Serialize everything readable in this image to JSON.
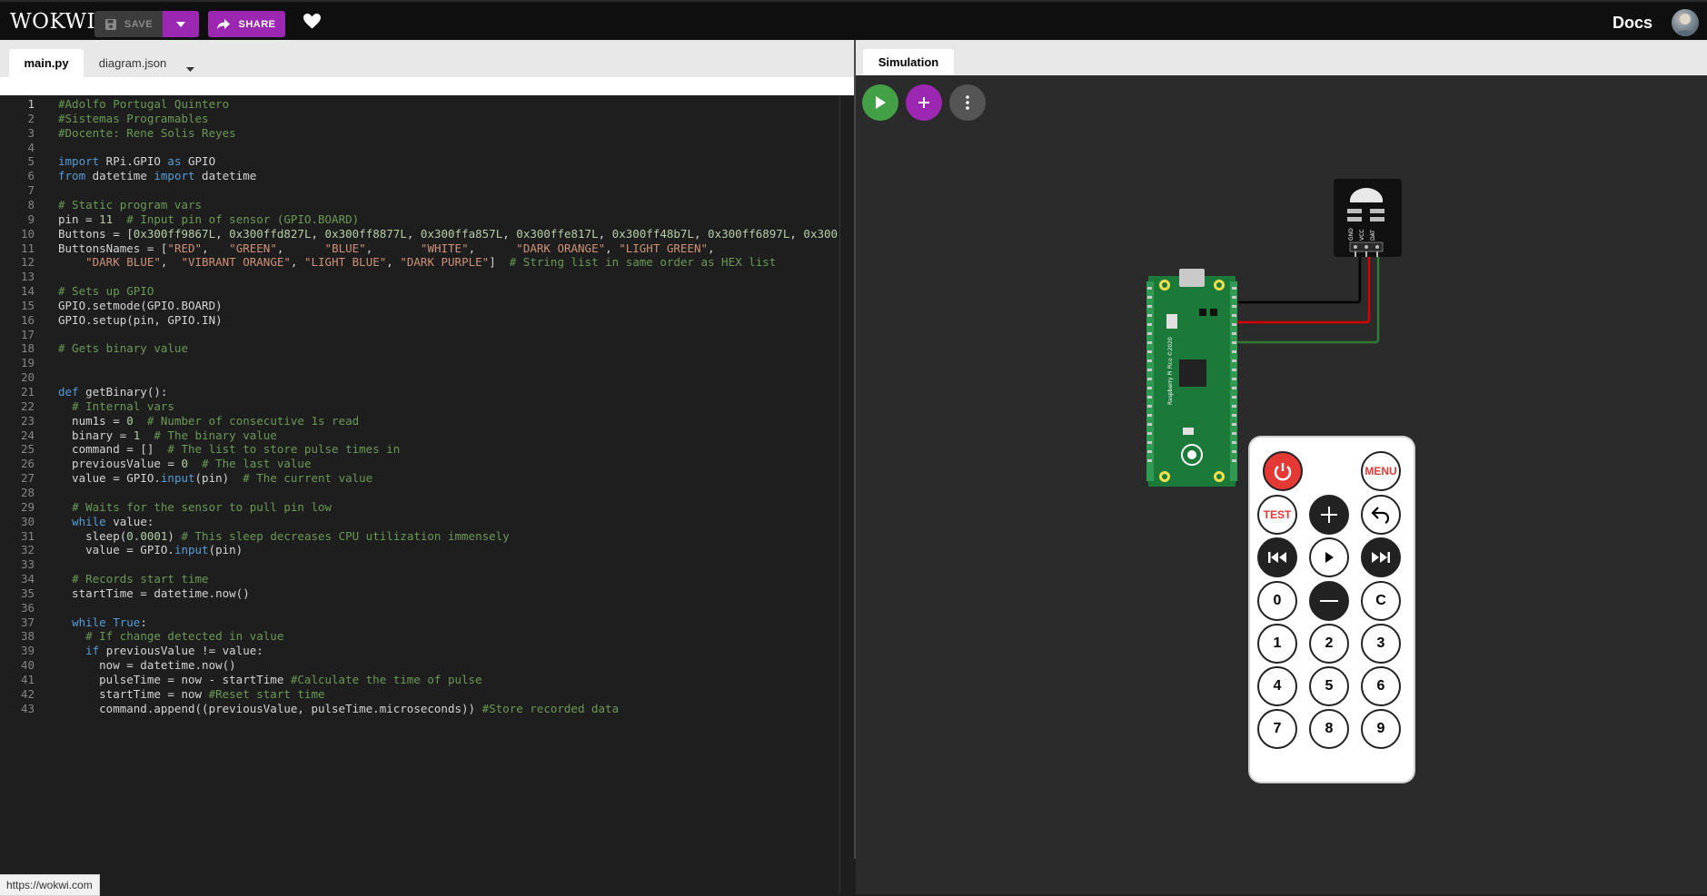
{
  "header": {
    "logo": "WOKWI",
    "save_label": "SAVE",
    "share_label": "SHARE",
    "docs_label": "Docs",
    "icons": {
      "save": "floppy-disk-icon",
      "save_dropdown": "caret-down-icon",
      "share": "share-arrow-icon",
      "like": "heart-icon",
      "avatar": "user-avatar"
    }
  },
  "editor": {
    "tabs": [
      {
        "label": "main.py",
        "active": true
      },
      {
        "label": "diagram.json",
        "active": false
      }
    ],
    "current_line": 1,
    "lines": [
      "#Adolfo Portugal Quintero",
      "#Sistemas Programables",
      "#Docente: Rene Solis Reyes",
      "",
      "import RPi.GPIO as GPIO",
      "from datetime import datetime",
      "",
      "# Static program vars",
      "pin = 11  # Input pin of sensor (GPIO.BOARD)",
      "Buttons = [0x300ff9867L, 0x300ffd827L, 0x300ff8877L, 0x300ffa857L, 0x300ffe817L, 0x300ff48b7L, 0x300ff6897L, 0x300",
      "ButtonsNames = [\"RED\",   \"GREEN\",      \"BLUE\",       \"WHITE\",      \"DARK ORANGE\", \"LIGHT GREEN\",",
      "    \"DARK BLUE\",  \"VIBRANT ORANGE\", \"LIGHT BLUE\", \"DARK PURPLE\"]  # String list in same order as HEX list",
      "",
      "# Sets up GPIO",
      "GPIO.setmode(GPIO.BOARD)",
      "GPIO.setup(pin, GPIO.IN)",
      "",
      "# Gets binary value",
      "",
      "",
      "def getBinary():",
      "  # Internal vars",
      "  num1s = 0  # Number of consecutive 1s read",
      "  binary = 1  # The binary value",
      "  command = []  # The list to store pulse times in",
      "  previousValue = 0  # The last value",
      "  value = GPIO.input(pin)  # The current value",
      "",
      "  # Waits for the sensor to pull pin low",
      "  while value:",
      "    sleep(0.0001) # This sleep decreases CPU utilization immensely",
      "    value = GPIO.input(pin)",
      "",
      "  # Records start time",
      "  startTime = datetime.now()",
      "",
      "  while True:",
      "    # If change detected in value",
      "    if previousValue != value:",
      "      now = datetime.now()",
      "      pulseTime = now - startTime #Calculate the time of pulse",
      "      startTime = now #Reset start time",
      "      command.append((previousValue, pulseTime.microseconds)) #Store recorded data"
    ]
  },
  "status_url": "https://wokwi.com",
  "simulation": {
    "tab_label": "Simulation",
    "buttons": {
      "play": "play-icon",
      "add_part": "plus-icon",
      "more": "more-vertical-icon"
    },
    "ir_receiver": {
      "pins": [
        "GND",
        "VCC",
        "DAT"
      ]
    },
    "pico": {
      "label": "Raspberry Pi Pico ©2020",
      "usb_label": "USB",
      "led_label": "LED",
      "bootsel_label": "BOOTSEL"
    },
    "wires": [
      {
        "name": "gnd-wire",
        "color": "#000000"
      },
      {
        "name": "vcc-wire",
        "color": "#d50000"
      },
      {
        "name": "data-wire",
        "color": "#2e7d32"
      }
    ],
    "remote": {
      "buttons": [
        {
          "id": "power",
          "label": "",
          "icon": "power-icon"
        },
        {
          "id": "menu",
          "label": "MENU"
        },
        {
          "id": "test",
          "label": "TEST"
        },
        {
          "id": "plus",
          "label": "",
          "icon": "plus-icon"
        },
        {
          "id": "back",
          "label": "",
          "icon": "return-icon"
        },
        {
          "id": "prev",
          "label": "",
          "icon": "rewind-icon"
        },
        {
          "id": "play",
          "label": "",
          "icon": "play-icon"
        },
        {
          "id": "next",
          "label": "",
          "icon": "fast-forward-icon"
        },
        {
          "id": "0",
          "label": "0"
        },
        {
          "id": "minus",
          "label": "",
          "icon": "minus-icon"
        },
        {
          "id": "c",
          "label": "C"
        },
        {
          "id": "1",
          "label": "1"
        },
        {
          "id": "2",
          "label": "2"
        },
        {
          "id": "3",
          "label": "3"
        },
        {
          "id": "4",
          "label": "4"
        },
        {
          "id": "5",
          "label": "5"
        },
        {
          "id": "6",
          "label": "6"
        },
        {
          "id": "7",
          "label": "7"
        },
        {
          "id": "8",
          "label": "8"
        },
        {
          "id": "9",
          "label": "9"
        }
      ]
    }
  }
}
